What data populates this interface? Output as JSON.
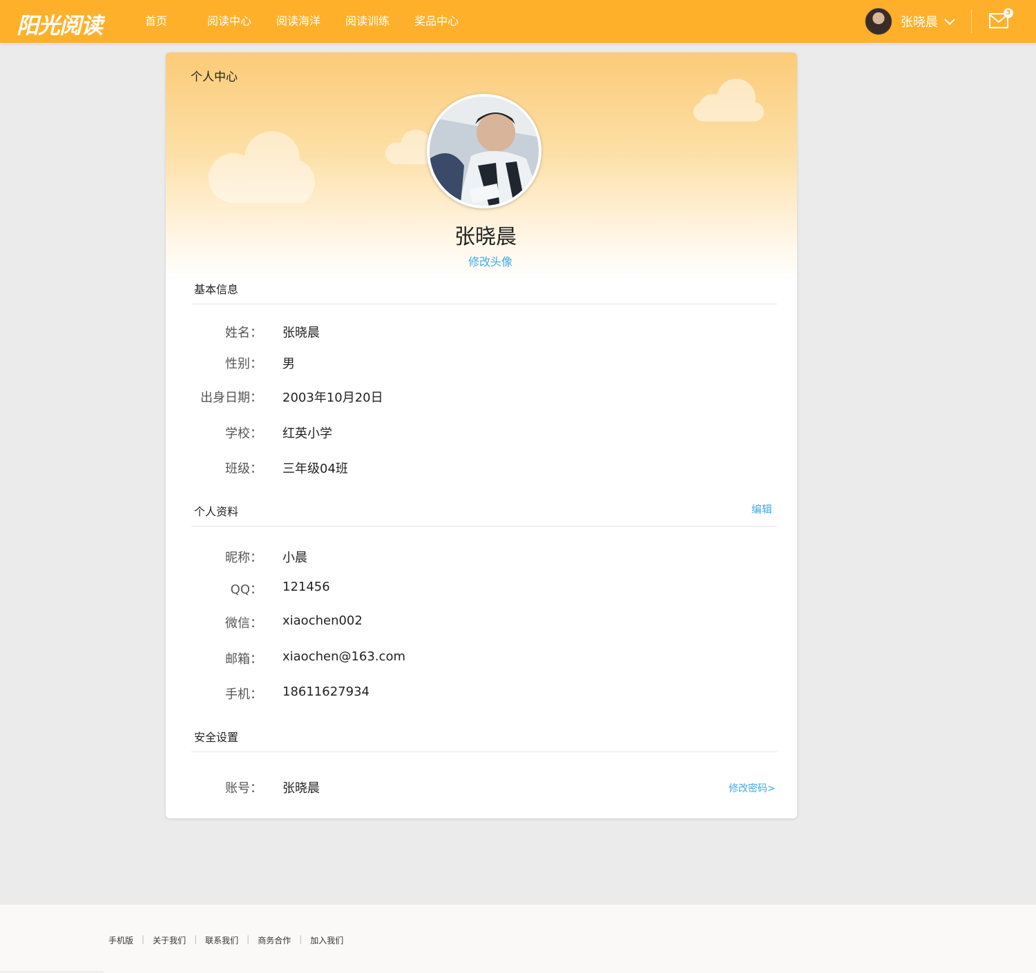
{
  "header": {
    "logo": "阳光阅读",
    "nav": [
      "首页",
      "阅读中心",
      "阅读海洋",
      "阅读训练",
      "奖品中心"
    ],
    "user_name": "张晓晨",
    "mail_count": "3",
    "brand_color": "#ffb02a"
  },
  "card": {
    "title": "个人中心",
    "name": "张晓晨",
    "change_avatar": "修改头像"
  },
  "basic": {
    "title": "基本信息",
    "rows": [
      {
        "label": "姓名：",
        "value": "张晓晨"
      },
      {
        "label": "性别：",
        "value": "男"
      },
      {
        "label": "出身日期：",
        "value": "2003年10月20日"
      },
      {
        "label": "学校：",
        "value": "红英小学"
      },
      {
        "label": "班级：",
        "value": "三年级04班"
      }
    ]
  },
  "profile": {
    "title": "个人资料",
    "edit": "编辑",
    "rows": [
      {
        "label": "昵称：",
        "value": "小晨"
      },
      {
        "label": "QQ：",
        "value": "121456"
      },
      {
        "label": "微信：",
        "value": "xiaochen002"
      },
      {
        "label": "邮箱：",
        "value": "xiaochen@163.com"
      },
      {
        "label": "手机：",
        "value": "18611627934"
      }
    ]
  },
  "security": {
    "title": "安全设置",
    "account_label": "账号：",
    "account_value": "张晓晨",
    "change_password": "修改密码>"
  },
  "footer": {
    "links": [
      "手机版",
      "关于我们",
      "联系我们",
      "商务合作",
      "加入我们"
    ]
  },
  "icons": {
    "chevron": "chevron-down-icon",
    "mail": "mail-icon",
    "cloud": "cloud-icon"
  }
}
